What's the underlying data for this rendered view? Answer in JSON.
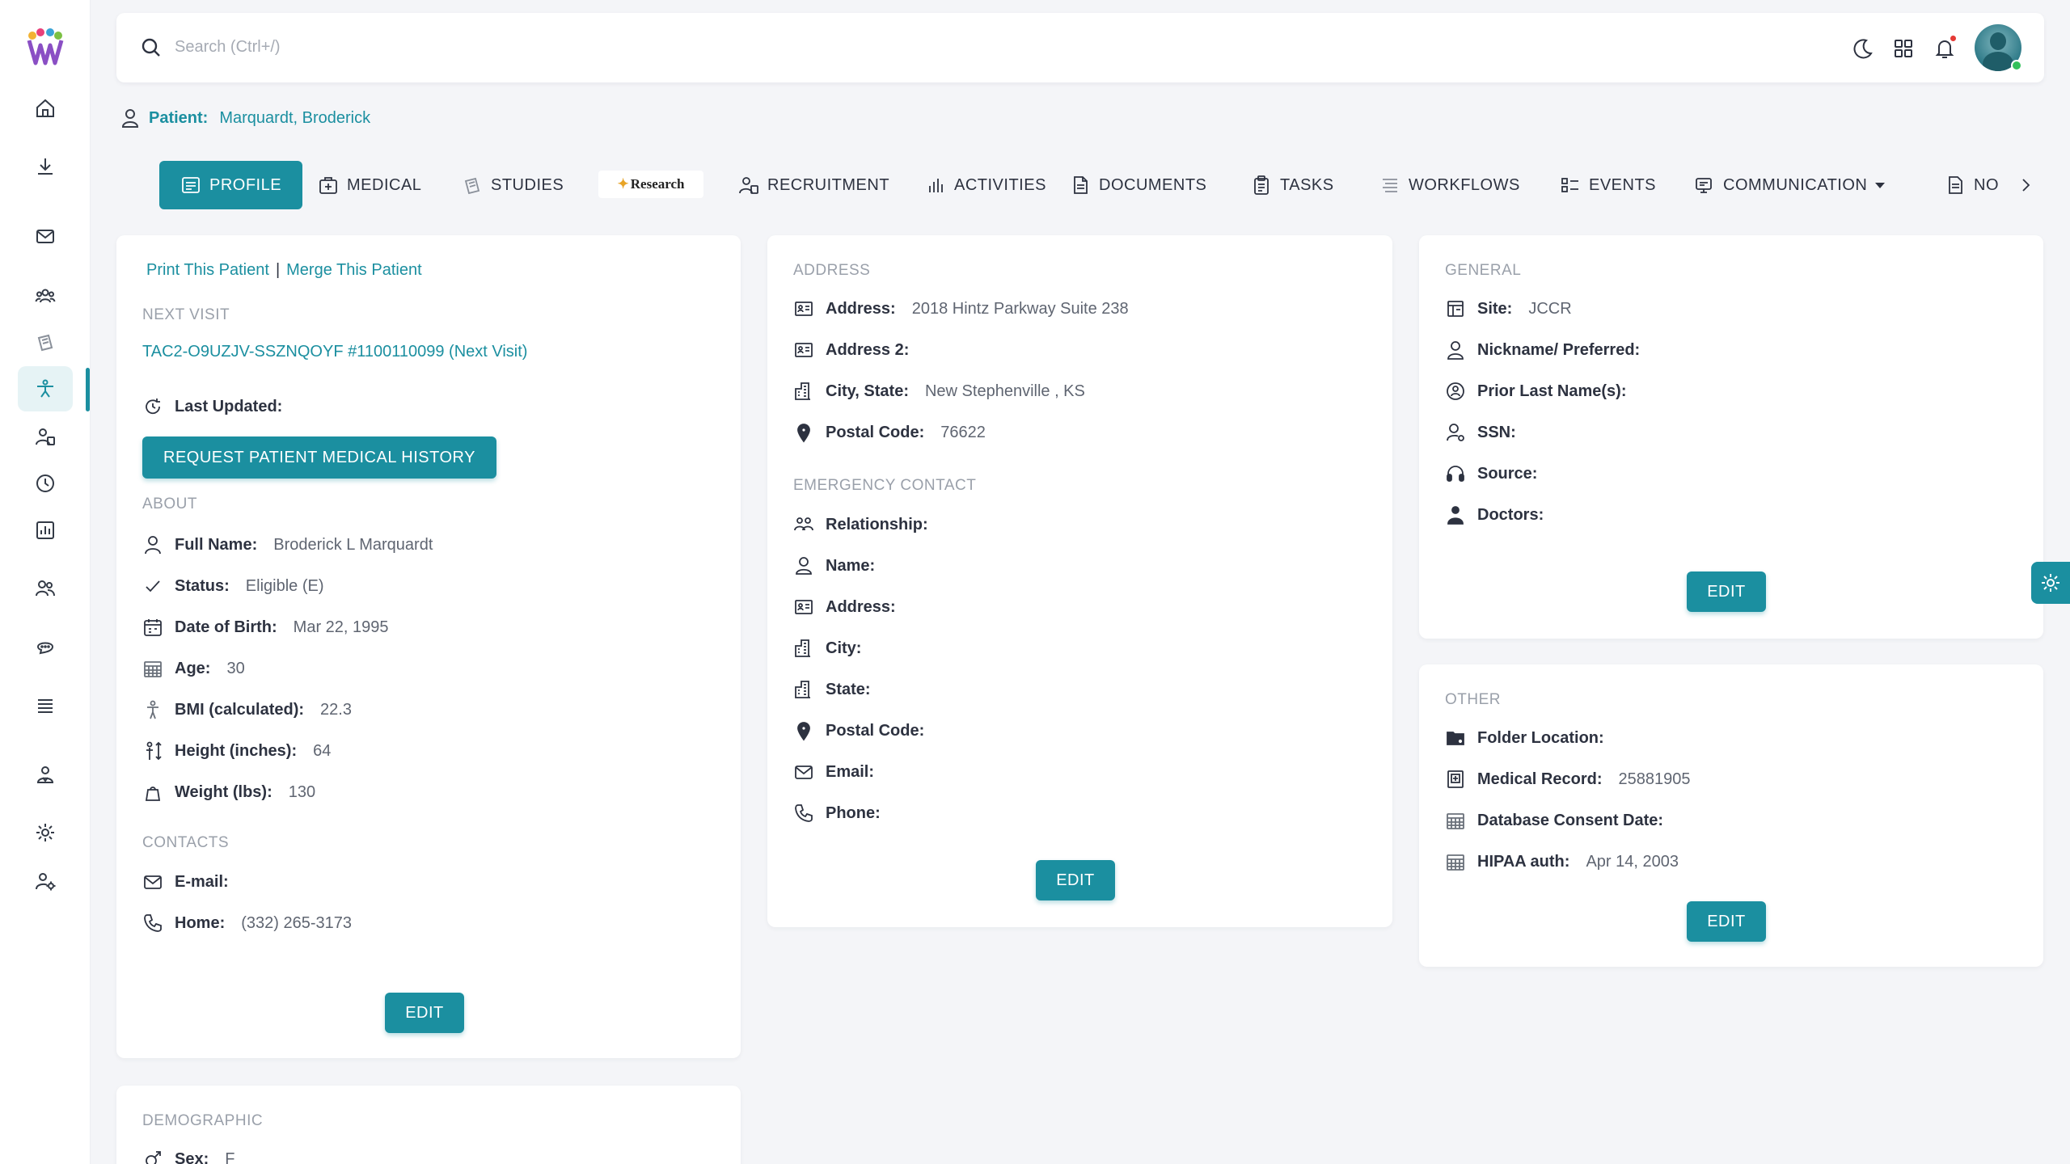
{
  "search": {
    "placeholder": "Search (Ctrl+/)"
  },
  "patient": {
    "label": "Patient:",
    "name": "Marquardt, Broderick"
  },
  "tabs": [
    {
      "label": "PROFILE",
      "icon": "profile-card-icon",
      "active": true
    },
    {
      "label": "MEDICAL",
      "icon": "medical-kit-icon"
    },
    {
      "label": "STUDIES",
      "icon": "studies-icon"
    },
    {
      "label": "Research",
      "icon": "research-logo"
    },
    {
      "label": "RECRUITMENT",
      "icon": "recruitment-icon"
    },
    {
      "label": "ACTIVITIES",
      "icon": "bar-chart-icon"
    },
    {
      "label": "DOCUMENTS",
      "icon": "document-icon"
    },
    {
      "label": "TASKS",
      "icon": "clipboard-icon"
    },
    {
      "label": "WORKFLOWS",
      "icon": "workflow-icon"
    },
    {
      "label": "EVENTS",
      "icon": "events-icon"
    },
    {
      "label": "COMMUNICATION",
      "icon": "communication-icon"
    },
    {
      "label": "NO",
      "icon": "notes-icon"
    }
  ],
  "left_card": {
    "print_link": "Print This Patient",
    "separator": "|",
    "merge_link": "Merge This Patient",
    "next_visit_title": "NEXT VISIT",
    "next_visit_link": "TAC2-O9UZJV-SSZNQOYF  #1100110099 (Next Visit)",
    "last_updated_label": "Last Updated:",
    "request_button": "REQUEST PATIENT MEDICAL HISTORY",
    "about_title": "ABOUT",
    "about": [
      {
        "label": "Full Name:",
        "value": "Broderick L Marquardt",
        "icon": "user-icon"
      },
      {
        "label": "Status:",
        "value": "Eligible (E)",
        "icon": "check-icon"
      },
      {
        "label": "Date of Birth:",
        "value": "Mar 22, 1995",
        "icon": "calendar-icon"
      },
      {
        "label": "Age:",
        "value": "30",
        "icon": "calendar-grid-icon"
      },
      {
        "label": "BMI (calculated):",
        "value": "22.3",
        "icon": "body-icon"
      },
      {
        "label": "Height (inches):",
        "value": "64",
        "icon": "height-icon"
      },
      {
        "label": "Weight (lbs):",
        "value": "130",
        "icon": "weight-icon"
      }
    ],
    "contacts_title": "CONTACTS",
    "contacts": [
      {
        "label": "E-mail:",
        "value": "",
        "icon": "mail-icon"
      },
      {
        "label": "Home:",
        "value": "(332) 265-3173",
        "icon": "phone-icon"
      }
    ],
    "edit": "EDIT"
  },
  "demographic": {
    "title": "DEMOGRAPHIC",
    "sex_label": "Sex:",
    "sex_value": "F"
  },
  "middle_card": {
    "address_title": "ADDRESS",
    "address": [
      {
        "label": "Address:",
        "value": "2018 Hintz Parkway Suite 238",
        "icon": "id-card-icon"
      },
      {
        "label": "Address 2:",
        "value": "",
        "icon": "id-card-icon"
      },
      {
        "label": "City, State:",
        "value": "New Stephenville , KS",
        "icon": "building-icon"
      },
      {
        "label": "Postal Code:",
        "value": "76622",
        "icon": "pin-icon"
      }
    ],
    "emergency_title": "EMERGENCY CONTACT",
    "emergency": [
      {
        "label": "Relationship:",
        "value": "",
        "icon": "people-icon"
      },
      {
        "label": "Name:",
        "value": "",
        "icon": "user-icon"
      },
      {
        "label": "Address:",
        "value": "",
        "icon": "id-card-icon"
      },
      {
        "label": "City:",
        "value": "",
        "icon": "building-icon"
      },
      {
        "label": "State:",
        "value": "",
        "icon": "building-icon"
      },
      {
        "label": "Postal Code:",
        "value": "",
        "icon": "pin-icon"
      },
      {
        "label": "Email:",
        "value": "",
        "icon": "mail-icon"
      },
      {
        "label": "Phone:",
        "value": "",
        "icon": "phone-icon"
      }
    ],
    "edit": "EDIT"
  },
  "general_card": {
    "title": "GENERAL",
    "rows": [
      {
        "label": "Site:",
        "value": "JCCR",
        "icon": "site-icon"
      },
      {
        "label": "Nickname/ Preferred:",
        "value": "",
        "icon": "user-icon"
      },
      {
        "label": "Prior Last Name(s):",
        "value": "",
        "icon": "badge-icon"
      },
      {
        "label": "SSN:",
        "value": "",
        "icon": "user-key-icon"
      },
      {
        "label": "Source:",
        "value": "",
        "icon": "headset-icon"
      },
      {
        "label": "Doctors:",
        "value": "",
        "icon": "doctor-icon"
      }
    ],
    "edit": "EDIT"
  },
  "other_card": {
    "title": "OTHER",
    "rows": [
      {
        "label": "Folder Location:",
        "value": "",
        "icon": "folder-icon"
      },
      {
        "label": "Medical Record:",
        "value": "25881905",
        "icon": "record-icon"
      },
      {
        "label": "Database Consent Date:",
        "value": "",
        "icon": "calendar-grid-icon"
      },
      {
        "label": "HIPAA auth:",
        "value": "Apr 14, 2003",
        "icon": "calendar-grid-icon"
      }
    ],
    "edit": "EDIT"
  },
  "colors": {
    "accent": "#1b8fa0",
    "muted": "#9aa0aa",
    "background": "#f4f5f8"
  }
}
